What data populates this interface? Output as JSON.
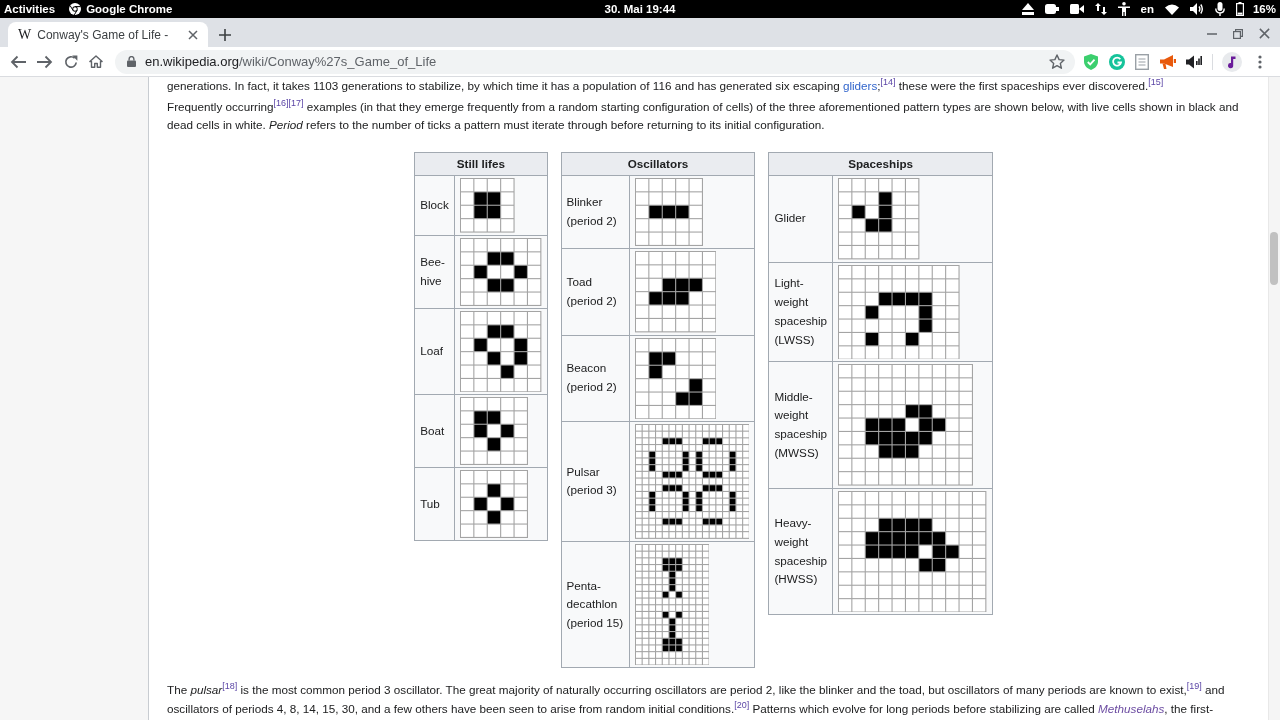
{
  "system_bar": {
    "activities": "Activities",
    "app_name": "Google Chrome",
    "clock": "30. Mai 19:44",
    "keyboard_layout": "en",
    "battery": "16%"
  },
  "browser": {
    "tab": {
      "favicon": "W",
      "title": "Conway's Game of Life -",
      "selected": true
    },
    "address": {
      "host": "en.wikipedia.org",
      "path": "/wiki/Conway%27s_Game_of_Life"
    }
  },
  "article": {
    "paragraphs_before": [
      {
        "segments": [
          {
            "kind": "text",
            "text": "generations. In fact, it takes 1103 generations to stabilize, by which time it has a population of 116 and has generated six escaping "
          },
          {
            "kind": "link",
            "text": "gliders",
            "visited": false,
            "italic": false
          },
          {
            "kind": "text",
            "text": ";"
          },
          {
            "kind": "ref",
            "text": "[14]"
          },
          {
            "kind": "text",
            "text": " these were the first spaceships ever discovered."
          },
          {
            "kind": "ref",
            "text": "[15]"
          }
        ]
      },
      {
        "segments": [
          {
            "kind": "text",
            "text": "Frequently occurring"
          },
          {
            "kind": "ref",
            "text": "[16]"
          },
          {
            "kind": "ref",
            "text": "[17]"
          },
          {
            "kind": "text",
            "text": " examples (in that they emerge frequently from a random starting configuration of cells) of the three aforementioned pattern types are shown below, with live cells shown in black and dead cells in white. *Period* refers to the number of ticks a pattern must iterate through before returning to its initial configuration."
          }
        ]
      }
    ],
    "pattern_tables": [
      {
        "title": "Still lifes",
        "patterns": [
          {
            "name": "Block",
            "cells": [
              [
                false,
                false,
                false,
                false
              ],
              [
                false,
                true,
                true,
                false
              ],
              [
                false,
                true,
                true,
                false
              ],
              [
                false,
                false,
                false,
                false
              ]
            ]
          },
          {
            "name": "Bee-hive",
            "cells": [
              [
                false,
                false,
                false,
                false,
                false,
                false
              ],
              [
                false,
                false,
                true,
                true,
                false,
                false
              ],
              [
                false,
                true,
                false,
                false,
                true,
                false
              ],
              [
                false,
                false,
                true,
                true,
                false,
                false
              ],
              [
                false,
                false,
                false,
                false,
                false,
                false
              ]
            ]
          },
          {
            "name": "Loaf",
            "cells": [
              [
                false,
                false,
                false,
                false,
                false,
                false
              ],
              [
                false,
                false,
                true,
                true,
                false,
                false
              ],
              [
                false,
                true,
                false,
                false,
                true,
                false
              ],
              [
                false,
                false,
                true,
                false,
                true,
                false
              ],
              [
                false,
                false,
                false,
                true,
                false,
                false
              ],
              [
                false,
                false,
                false,
                false,
                false,
                false
              ]
            ]
          },
          {
            "name": "Boat",
            "cells": [
              [
                false,
                false,
                false,
                false,
                false
              ],
              [
                false,
                true,
                true,
                false,
                false
              ],
              [
                false,
                true,
                false,
                true,
                false
              ],
              [
                false,
                false,
                true,
                false,
                false
              ],
              [
                false,
                false,
                false,
                false,
                false
              ]
            ]
          },
          {
            "name": "Tub",
            "cells": [
              [
                false,
                false,
                false,
                false,
                false
              ],
              [
                false,
                false,
                true,
                false,
                false
              ],
              [
                false,
                true,
                false,
                true,
                false
              ],
              [
                false,
                false,
                true,
                false,
                false
              ],
              [
                false,
                false,
                false,
                false,
                false
              ]
            ]
          }
        ]
      },
      {
        "title": "Oscillators",
        "patterns": [
          {
            "name": "Blinker (period 2)",
            "cells": [
              [
                false,
                false,
                false,
                false,
                false
              ],
              [
                false,
                false,
                false,
                false,
                false
              ],
              [
                false,
                true,
                true,
                true,
                false
              ],
              [
                false,
                false,
                false,
                false,
                false
              ],
              [
                false,
                false,
                false,
                false,
                false
              ]
            ]
          },
          {
            "name": "Toad (period 2)",
            "cells": [
              [
                false,
                false,
                false,
                false,
                false,
                false
              ],
              [
                false,
                false,
                false,
                false,
                false,
                false
              ],
              [
                false,
                false,
                true,
                true,
                true,
                false
              ],
              [
                false,
                true,
                true,
                true,
                false,
                false
              ],
              [
                false,
                false,
                false,
                false,
                false,
                false
              ],
              [
                false,
                false,
                false,
                false,
                false,
                false
              ]
            ]
          },
          {
            "name": "Beacon (period 2)",
            "cells": [
              [
                false,
                false,
                false,
                false,
                false,
                false
              ],
              [
                false,
                true,
                true,
                false,
                false,
                false
              ],
              [
                false,
                true,
                false,
                false,
                false,
                false
              ],
              [
                false,
                false,
                false,
                false,
                true,
                false
              ],
              [
                false,
                false,
                false,
                true,
                true,
                false
              ],
              [
                false,
                false,
                false,
                false,
                false,
                false
              ]
            ]
          },
          {
            "name": "Pulsar (period 3)",
            "cells": [
              [
                false,
                false,
                false,
                false,
                false,
                false,
                false,
                false,
                false,
                false,
                false,
                false,
                false,
                false,
                false,
                false,
                false
              ],
              [
                false,
                false,
                false,
                false,
                false,
                false,
                false,
                false,
                false,
                false,
                false,
                false,
                false,
                false,
                false,
                false,
                false
              ],
              [
                false,
                false,
                false,
                false,
                true,
                true,
                true,
                false,
                false,
                false,
                true,
                true,
                true,
                false,
                false,
                false,
                false
              ],
              [
                false,
                false,
                false,
                false,
                false,
                false,
                false,
                false,
                false,
                false,
                false,
                false,
                false,
                false,
                false,
                false,
                false
              ],
              [
                false,
                false,
                true,
                false,
                false,
                false,
                false,
                true,
                false,
                true,
                false,
                false,
                false,
                false,
                true,
                false,
                false
              ],
              [
                false,
                false,
                true,
                false,
                false,
                false,
                false,
                true,
                false,
                true,
                false,
                false,
                false,
                false,
                true,
                false,
                false
              ],
              [
                false,
                false,
                true,
                false,
                false,
                false,
                false,
                true,
                false,
                true,
                false,
                false,
                false,
                false,
                true,
                false,
                false
              ],
              [
                false,
                false,
                false,
                false,
                true,
                true,
                true,
                false,
                false,
                false,
                true,
                true,
                true,
                false,
                false,
                false,
                false
              ],
              [
                false,
                false,
                false,
                false,
                false,
                false,
                false,
                false,
                false,
                false,
                false,
                false,
                false,
                false,
                false,
                false,
                false
              ],
              [
                false,
                false,
                false,
                false,
                true,
                true,
                true,
                false,
                false,
                false,
                true,
                true,
                true,
                false,
                false,
                false,
                false
              ],
              [
                false,
                false,
                true,
                false,
                false,
                false,
                false,
                true,
                false,
                true,
                false,
                false,
                false,
                false,
                true,
                false,
                false
              ],
              [
                false,
                false,
                true,
                false,
                false,
                false,
                false,
                true,
                false,
                true,
                false,
                false,
                false,
                false,
                true,
                false,
                false
              ],
              [
                false,
                false,
                true,
                false,
                false,
                false,
                false,
                true,
                false,
                true,
                false,
                false,
                false,
                false,
                true,
                false,
                false
              ],
              [
                false,
                false,
                false,
                false,
                false,
                false,
                false,
                false,
                false,
                false,
                false,
                false,
                false,
                false,
                false,
                false,
                false
              ],
              [
                false,
                false,
                false,
                false,
                true,
                true,
                true,
                false,
                false,
                false,
                true,
                true,
                true,
                false,
                false,
                false,
                false
              ],
              [
                false,
                false,
                false,
                false,
                false,
                false,
                false,
                false,
                false,
                false,
                false,
                false,
                false,
                false,
                false,
                false,
                false
              ],
              [
                false,
                false,
                false,
                false,
                false,
                false,
                false,
                false,
                false,
                false,
                false,
                false,
                false,
                false,
                false,
                false,
                false
              ]
            ]
          },
          {
            "name": "Penta-decathlon (period 15)",
            "cells": [
              [
                false,
                false,
                false,
                false,
                false,
                false,
                false,
                false,
                false,
                false,
                false
              ],
              [
                false,
                false,
                false,
                false,
                false,
                false,
                false,
                false,
                false,
                false,
                false
              ],
              [
                false,
                false,
                false,
                false,
                true,
                true,
                true,
                false,
                false,
                false,
                false
              ],
              [
                false,
                false,
                false,
                false,
                true,
                true,
                true,
                false,
                false,
                false,
                false
              ],
              [
                false,
                false,
                false,
                false,
                false,
                true,
                false,
                false,
                false,
                false,
                false
              ],
              [
                false,
                false,
                false,
                false,
                false,
                true,
                false,
                false,
                false,
                false,
                false
              ],
              [
                false,
                false,
                false,
                false,
                false,
                true,
                false,
                false,
                false,
                false,
                false
              ],
              [
                false,
                false,
                false,
                false,
                true,
                false,
                true,
                false,
                false,
                false,
                false
              ],
              [
                false,
                false,
                false,
                false,
                false,
                false,
                false,
                false,
                false,
                false,
                false
              ],
              [
                false,
                false,
                false,
                false,
                false,
                false,
                false,
                false,
                false,
                false,
                false
              ],
              [
                false,
                false,
                false,
                false,
                true,
                false,
                true,
                false,
                false,
                false,
                false
              ],
              [
                false,
                false,
                false,
                false,
                false,
                true,
                false,
                false,
                false,
                false,
                false
              ],
              [
                false,
                false,
                false,
                false,
                false,
                true,
                false,
                false,
                false,
                false,
                false
              ],
              [
                false,
                false,
                false,
                false,
                false,
                true,
                false,
                false,
                false,
                false,
                false
              ],
              [
                false,
                false,
                false,
                false,
                true,
                true,
                true,
                false,
                false,
                false,
                false
              ],
              [
                false,
                false,
                false,
                false,
                true,
                true,
                true,
                false,
                false,
                false,
                false
              ],
              [
                false,
                false,
                false,
                false,
                false,
                false,
                false,
                false,
                false,
                false,
                false
              ],
              [
                false,
                false,
                false,
                false,
                false,
                false,
                false,
                false,
                false,
                false,
                false
              ]
            ]
          }
        ]
      },
      {
        "title": "Spaceships",
        "patterns": [
          {
            "name": "Glider",
            "cells": [
              [
                false,
                false,
                false,
                false,
                false,
                false
              ],
              [
                false,
                false,
                false,
                true,
                false,
                false
              ],
              [
                false,
                true,
                false,
                true,
                false,
                false
              ],
              [
                false,
                false,
                true,
                true,
                false,
                false
              ],
              [
                false,
                false,
                false,
                false,
                false,
                false
              ],
              [
                false,
                false,
                false,
                false,
                false,
                false
              ]
            ]
          },
          {
            "name": "Light-weight spaceship (LWSS)",
            "cells": [
              [
                false,
                false,
                false,
                false,
                false,
                false,
                false,
                false,
                false
              ],
              [
                false,
                false,
                false,
                false,
                false,
                false,
                false,
                false,
                false
              ],
              [
                false,
                false,
                false,
                true,
                true,
                true,
                true,
                false,
                false
              ],
              [
                false,
                false,
                true,
                false,
                false,
                false,
                true,
                false,
                false
              ],
              [
                false,
                false,
                false,
                false,
                false,
                false,
                true,
                false,
                false
              ],
              [
                false,
                false,
                true,
                false,
                false,
                true,
                false,
                false,
                false
              ],
              [
                false,
                false,
                false,
                false,
                false,
                false,
                false,
                false,
                false
              ]
            ]
          },
          {
            "name": "Middle-weight spaceship (MWSS)",
            "cells": [
              [
                false,
                false,
                false,
                false,
                false,
                false,
                false,
                false,
                false,
                false
              ],
              [
                false,
                false,
                false,
                false,
                false,
                false,
                false,
                false,
                false,
                false
              ],
              [
                false,
                false,
                false,
                false,
                false,
                false,
                false,
                false,
                false,
                false
              ],
              [
                false,
                false,
                false,
                false,
                false,
                true,
                true,
                false,
                false,
                false
              ],
              [
                false,
                false,
                true,
                true,
                true,
                false,
                true,
                true,
                false,
                false
              ],
              [
                false,
                false,
                true,
                true,
                true,
                true,
                true,
                false,
                false,
                false
              ],
              [
                false,
                false,
                false,
                true,
                true,
                true,
                false,
                false,
                false,
                false
              ],
              [
                false,
                false,
                false,
                false,
                false,
                false,
                false,
                false,
                false,
                false
              ],
              [
                false,
                false,
                false,
                false,
                false,
                false,
                false,
                false,
                false,
                false
              ]
            ]
          },
          {
            "name": "Heavy-weight spaceship (HWSS)",
            "cells": [
              [
                false,
                false,
                false,
                false,
                false,
                false,
                false,
                false,
                false,
                false,
                false
              ],
              [
                false,
                false,
                false,
                false,
                false,
                false,
                false,
                false,
                false,
                false,
                false
              ],
              [
                false,
                false,
                false,
                true,
                true,
                true,
                true,
                false,
                false,
                false,
                false
              ],
              [
                false,
                false,
                true,
                true,
                true,
                true,
                true,
                true,
                false,
                false,
                false
              ],
              [
                false,
                false,
                true,
                true,
                true,
                true,
                false,
                true,
                true,
                false,
                false
              ],
              [
                false,
                false,
                false,
                false,
                false,
                false,
                true,
                true,
                false,
                false,
                false
              ],
              [
                false,
                false,
                false,
                false,
                false,
                false,
                false,
                false,
                false,
                false,
                false
              ],
              [
                false,
                false,
                false,
                false,
                false,
                false,
                false,
                false,
                false,
                false,
                false
              ],
              [
                false,
                false,
                false,
                false,
                false,
                false,
                false,
                false,
                false,
                false,
                false
              ]
            ]
          }
        ]
      }
    ],
    "paragraphs_after": [
      {
        "segments": [
          {
            "kind": "text",
            "text": "The *pulsar*"
          },
          {
            "kind": "ref",
            "text": "[18]"
          },
          {
            "kind": "text",
            "text": " is the most common period 3 oscillator. The great majority of naturally occurring oscillators are period 2, like the blinker and the toad, but oscillators of many periods are known to exist,"
          },
          {
            "kind": "ref",
            "text": "[19]"
          },
          {
            "kind": "text",
            "text": " and oscillators of periods 4, 8, 14, 15, 30, and a few others have been seen to arise from random initial conditions."
          },
          {
            "kind": "ref",
            "text": "[20]"
          },
          {
            "kind": "text",
            "text": " Patterns which evolve for long periods before stabilizing are called "
          },
          {
            "kind": "link",
            "text": "Methuselahs",
            "visited": true,
            "italic": true
          },
          {
            "kind": "text",
            "text": ", the first-"
          }
        ]
      }
    ]
  }
}
